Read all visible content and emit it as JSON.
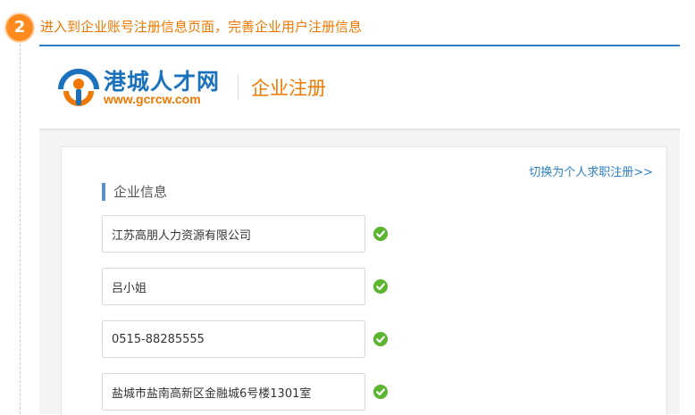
{
  "step": {
    "number": "2",
    "text": "进入到企业账号注册信息页面，完善企业用户注册信息"
  },
  "logo": {
    "title": "港城人才网",
    "url": "www.gcrcw.com"
  },
  "header": {
    "title": "企业注册"
  },
  "panel": {
    "switch_link": "切换为个人求职注册>>",
    "section_title": "企业信息",
    "fields": [
      {
        "value": "江苏高朋人力资源有限公司"
      },
      {
        "value": "吕小姐"
      },
      {
        "value": "0515-88285555"
      },
      {
        "value": "盐城市盐南高新区金融城6号楼1301室"
      }
    ]
  },
  "colors": {
    "accent_orange": "#f07800",
    "brand_blue": "#1b72bc",
    "success_green": "#5cb531"
  }
}
